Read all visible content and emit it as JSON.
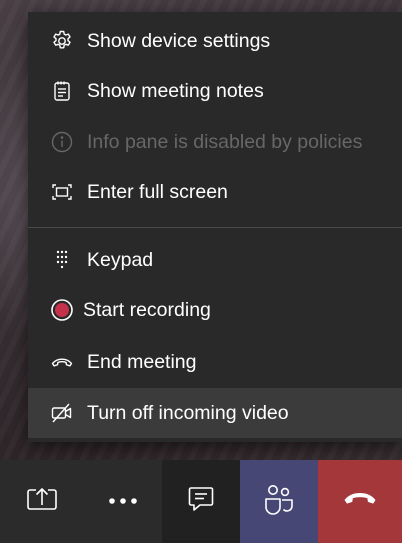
{
  "menu": {
    "items": [
      {
        "label": "Show device settings",
        "icon": "gear-icon",
        "enabled": true
      },
      {
        "label": "Show meeting notes",
        "icon": "notes-icon",
        "enabled": true
      },
      {
        "label": "Info pane is disabled by policies",
        "icon": "info-icon",
        "enabled": false
      },
      {
        "label": "Enter full screen",
        "icon": "fullscreen-icon",
        "enabled": true
      },
      {
        "label": "Keypad",
        "icon": "keypad-icon",
        "enabled": true
      },
      {
        "label": "Start recording",
        "icon": "record-icon",
        "enabled": true
      },
      {
        "label": "End meeting",
        "icon": "end-meeting-icon",
        "enabled": true
      },
      {
        "label": "Turn off incoming video",
        "icon": "video-off-icon",
        "enabled": true,
        "highlighted": true
      }
    ]
  },
  "toolbar": {
    "buttons": [
      {
        "name": "share",
        "icon": "share-screen-icon"
      },
      {
        "name": "more",
        "icon": "more-icon"
      },
      {
        "name": "chat",
        "icon": "chat-icon"
      },
      {
        "name": "people",
        "icon": "people-icon"
      },
      {
        "name": "hangup",
        "icon": "hang-up-icon"
      }
    ]
  },
  "colors": {
    "menu_bg": "#292929",
    "text": "#ffffff",
    "disabled_text": "#676767",
    "highlight_bg": "#3b3b3b",
    "record_red": "#c4314b",
    "people_bg": "#464775",
    "hangup_bg": "#a4373a"
  }
}
